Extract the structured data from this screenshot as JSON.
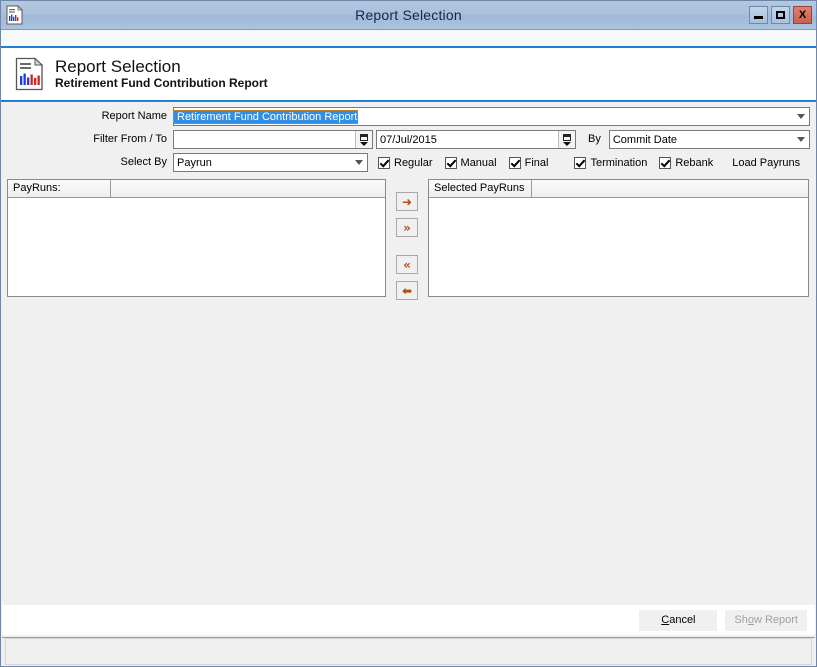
{
  "window": {
    "title": "Report Selection",
    "icon": "report-chart-icon",
    "controls": {
      "minimize": "minimize-icon",
      "maximize": "maximize-icon",
      "close": "X"
    }
  },
  "banner": {
    "icon": "report-chart-icon",
    "title": "Report Selection",
    "subtitle": "Retirement Fund Contribution Report"
  },
  "form": {
    "report_name": {
      "label": "Report Name",
      "value": "Retirement Fund Contribution Report",
      "selected": true
    },
    "filter": {
      "label": "Filter From / To",
      "from_value": "",
      "to_value": "07/Jul/2015",
      "by_label": "By",
      "by_value": "Commit Date"
    },
    "select_by": {
      "label": "Select By",
      "value": "Payrun"
    },
    "checkboxes": [
      {
        "label": "Regular",
        "checked": true
      },
      {
        "label": "Manual",
        "checked": true
      },
      {
        "label": "Final",
        "checked": true
      },
      {
        "label": "Termination",
        "checked": true
      },
      {
        "label": "Rebank",
        "checked": true
      }
    ],
    "load_payruns_label": "Load Payruns"
  },
  "lists": {
    "left": {
      "column1": "PayRuns:",
      "column2": "",
      "rows": []
    },
    "right": {
      "column1": "Selected PayRuns",
      "column2": "",
      "rows": []
    },
    "transfer_buttons": [
      {
        "name": "move-right",
        "glyph": "➜"
      },
      {
        "name": "move-all-right",
        "glyph": "»"
      },
      {
        "name": "move-all-left",
        "glyph": "«"
      },
      {
        "name": "move-left",
        "glyph": "⬅"
      }
    ]
  },
  "footer": {
    "cancel": {
      "pre": "",
      "accel": "C",
      "post": "ancel"
    },
    "show_report": {
      "pre": "Sh",
      "accel": "o",
      "post": "w Report",
      "disabled": true
    }
  },
  "colors": {
    "titlebar": "#a8c0dc",
    "accent_rule": "#1e7fd4",
    "selection": "#2f8fe8",
    "arrow": "#b34d14",
    "close_button": "#cd5f4c"
  }
}
